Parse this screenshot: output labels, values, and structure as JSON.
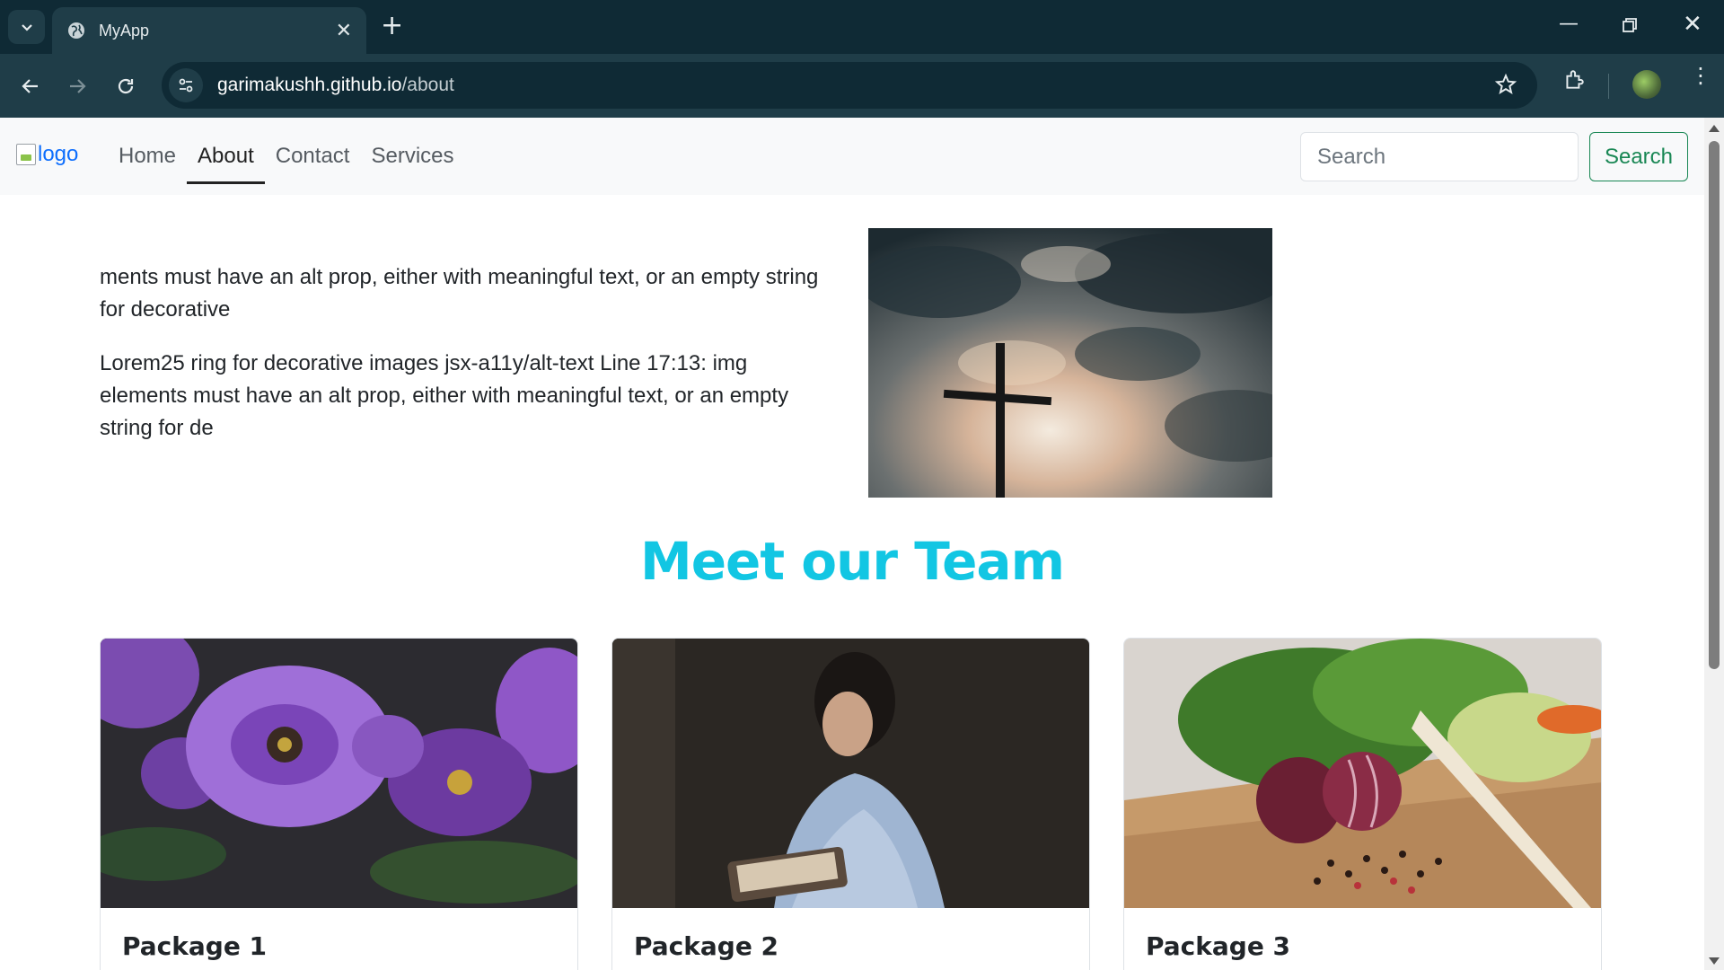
{
  "browser": {
    "tab_title": "MyApp",
    "url_host": "garimakushh.github.io",
    "url_path": "/about"
  },
  "navbar": {
    "logo_alt": "logo",
    "links": [
      {
        "label": "Home"
      },
      {
        "label": "About"
      },
      {
        "label": "Contact"
      },
      {
        "label": "Services"
      }
    ],
    "active": "About",
    "search_placeholder": "Search",
    "search_button": "Search"
  },
  "about": {
    "paragraphs": [
      "ments must have an alt prop, either with meaningful text, or an empty string for decorative",
      "Lorem25 ring for decorative images jsx-a11y/alt-text Line 17:13: img elements must have an alt prop, either with meaningful text, or an empty string for de"
    ]
  },
  "team": {
    "title": "Meet our Team",
    "cards": [
      {
        "title": "Package 1"
      },
      {
        "title": "Package 2"
      },
      {
        "title": "Package 3"
      }
    ]
  },
  "colors": {
    "accent_title": "#12c6e3",
    "search_button": "#198754",
    "chrome_dark": "#0f2a35"
  }
}
